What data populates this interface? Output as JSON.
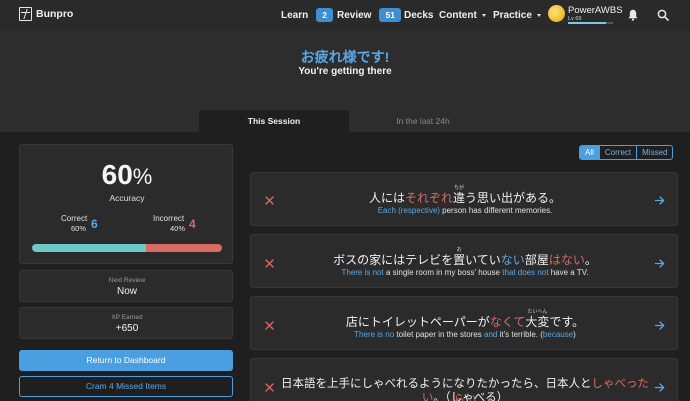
{
  "nav": {
    "logo_text": "Bunpro",
    "learn_label": "Learn",
    "learn_count": "2",
    "review_label": "Review",
    "review_count": "51",
    "decks_label": "Decks",
    "content_label": "Content",
    "practice_label": "Practice",
    "user_name": "PowerAWBS",
    "user_level": "Lv 69",
    "user_xp_progress": 0.85
  },
  "header": {
    "jp_title": "お疲れ様です!",
    "subtitle": "You're getting there"
  },
  "tabs": [
    {
      "label": "This Session",
      "active": true
    },
    {
      "label": "In the last 24h",
      "active": false
    }
  ],
  "stats": {
    "accuracy_value": "60",
    "accuracy_unit": "%",
    "accuracy_label": "Accuracy",
    "correct_label": "Correct",
    "correct_pct": "60%",
    "correct_count": "6",
    "incorrect_label": "Incorrect",
    "incorrect_pct": "40%",
    "incorrect_count": "4",
    "correct_fraction": 0.6,
    "next_review_label": "Next Review",
    "next_review_value": "Now",
    "xp_label": "XP Earned",
    "xp_value": "+650"
  },
  "buttons": {
    "dashboard": "Return to Dashboard",
    "cram": "Cram 4 Missed Items"
  },
  "filters": [
    "All",
    "Correct",
    "Missed"
  ],
  "items": [
    {
      "jp": [
        [
          "人には",
          ""
        ],
        [
          "それぞれ",
          "red"
        ],
        [
          "違",
          "",
          "ちが"
        ],
        [
          "う思い出がある。",
          ""
        ]
      ],
      "en": [
        [
          "Each (respective)",
          "blue"
        ],
        [
          " person has different memories.",
          ""
        ]
      ]
    },
    {
      "jp": [
        [
          "ボスの家にはテレビを",
          ""
        ],
        [
          "置",
          "",
          "お"
        ],
        [
          "いてい",
          ""
        ],
        [
          "ない",
          "blue"
        ],
        [
          "部屋",
          ""
        ],
        [
          "はない",
          "red"
        ],
        [
          "。",
          ""
        ]
      ],
      "en": [
        [
          "There is not",
          "blue"
        ],
        [
          " a single room in my boss' house ",
          ""
        ],
        [
          "that does not",
          "blue"
        ],
        [
          " have a TV.",
          ""
        ]
      ]
    },
    {
      "jp": [
        [
          "店にトイレットペーパーが",
          ""
        ],
        [
          "なくて",
          "red"
        ],
        [
          "大変",
          "",
          "たいへん"
        ],
        [
          "です。",
          ""
        ]
      ],
      "en": [
        [
          "There is no",
          "blue"
        ],
        [
          " toilet paper in the stores ",
          ""
        ],
        [
          "and",
          "blue"
        ],
        [
          " it's terrible. (",
          ""
        ],
        [
          "because",
          "blue"
        ],
        [
          ")",
          ""
        ]
      ]
    },
    {
      "jp": [
        [
          "日本語を上手にしゃべれるようになりたかったら、日本人と",
          ""
        ],
        [
          "しゃべったらい",
          "red"
        ]
      ],
      "jp2": [
        [
          "い",
          "red"
        ],
        [
          "。（しゃべる）",
          ""
        ]
      ]
    }
  ]
}
